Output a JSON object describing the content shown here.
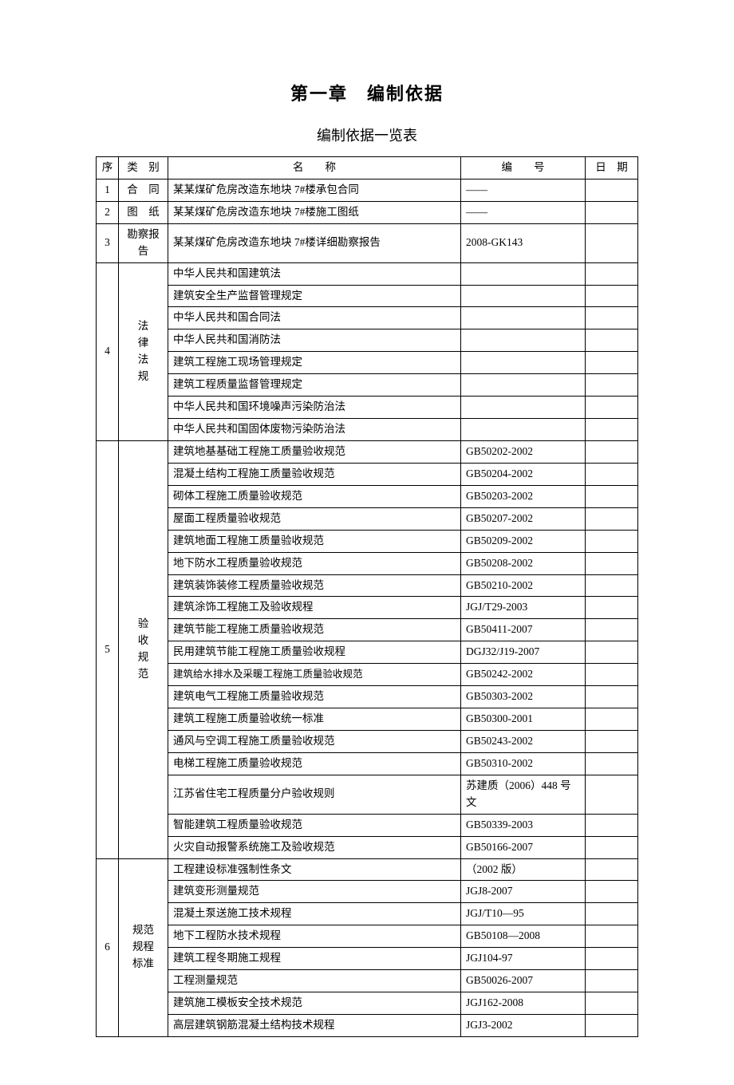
{
  "title": "第一章　编制依据",
  "subtitle": "编制依据一览表",
  "headers": {
    "seq": "序",
    "category": "类　别",
    "name": "名　　称",
    "code": "编　　号",
    "date": "日　期"
  },
  "rows": [
    {
      "seq": "1",
      "category": "合　同",
      "name": "某某煤矿危房改造东地块 7#楼承包合同",
      "code": "——",
      "date": ""
    },
    {
      "seq": "2",
      "category": "图　纸",
      "name": "某某煤矿危房改造东地块 7#楼施工图纸",
      "code": "——",
      "date": ""
    },
    {
      "seq": "3",
      "category": "勘察报告",
      "name": "某某煤矿危房改造东地块 7#楼详细勘察报告",
      "code": "2008-GK143",
      "date": ""
    }
  ],
  "group4": {
    "seq": "4",
    "category_lines": [
      "法",
      "律",
      "法",
      "规"
    ],
    "items": [
      {
        "name": "中华人民共和国建筑法",
        "code": "",
        "date": ""
      },
      {
        "name": "建筑安全生产监督管理规定",
        "code": "",
        "date": ""
      },
      {
        "name": "中华人民共和国合同法",
        "code": "",
        "date": ""
      },
      {
        "name": "中华人民共和国消防法",
        "code": "",
        "date": ""
      },
      {
        "name": "建筑工程施工现场管理规定",
        "code": "",
        "date": ""
      },
      {
        "name": "建筑工程质量监督管理规定",
        "code": "",
        "date": ""
      },
      {
        "name": "中华人民共和国环境噪声污染防治法",
        "code": "",
        "date": ""
      },
      {
        "name": "中华人民共和国固体废物污染防治法",
        "code": "",
        "date": ""
      }
    ]
  },
  "group5": {
    "seq": "5",
    "category_lines": [
      "验",
      "收",
      "规",
      "范"
    ],
    "items": [
      {
        "name": "建筑地基基础工程施工质量验收规范",
        "code": "GB50202-2002",
        "date": ""
      },
      {
        "name": "混凝土结构工程施工质量验收规范",
        "code": "GB50204-2002",
        "date": ""
      },
      {
        "name": "砌体工程施工质量验收规范",
        "code": "GB50203-2002",
        "date": ""
      },
      {
        "name": "屋面工程质量验收规范",
        "code": "GB50207-2002",
        "date": ""
      },
      {
        "name": "建筑地面工程施工质量验收规范",
        "code": "GB50209-2002",
        "date": ""
      },
      {
        "name": "地下防水工程质量验收规范",
        "code": "GB50208-2002",
        "date": ""
      },
      {
        "name": "建筑装饰装修工程质量验收规范",
        "code": "GB50210-2002",
        "date": ""
      },
      {
        "name": "建筑涂饰工程施工及验收规程",
        "code": "JGJ/T29-2003",
        "date": ""
      },
      {
        "name": "建筑节能工程施工质量验收规范",
        "code": "GB50411-2007",
        "date": ""
      },
      {
        "name": "民用建筑节能工程施工质量验收规程",
        "code": "DGJ32/J19-2007",
        "date": ""
      },
      {
        "name": "建筑给水排水及采暖工程施工质量验收规范",
        "code": "GB50242-2002",
        "date": "",
        "small": true
      },
      {
        "name": "建筑电气工程施工质量验收规范",
        "code": "GB50303-2002",
        "date": ""
      },
      {
        "name": "建筑工程施工质量验收统一标准",
        "code": "GB50300-2001",
        "date": ""
      },
      {
        "name": "通风与空调工程施工质量验收规范",
        "code": "GB50243-2002",
        "date": ""
      },
      {
        "name": "电梯工程施工质量验收规范",
        "code": "GB50310-2002",
        "date": ""
      },
      {
        "name": "江苏省住宅工程质量分户验收规则",
        "code": "苏建质（2006）448 号文",
        "date": ""
      },
      {
        "name": "智能建筑工程质量验收规范",
        "code": "GB50339-2003",
        "date": ""
      },
      {
        "name": "火灾自动报警系统施工及验收规范",
        "code": "GB50166-2007",
        "date": ""
      }
    ]
  },
  "group6": {
    "seq": "6",
    "category_lines": [
      "规范",
      "规程",
      "标准"
    ],
    "items": [
      {
        "name": "工程建设标准强制性条文",
        "code": "（2002 版）",
        "date": ""
      },
      {
        "name": "建筑变形测量规范",
        "code": "JGJ8-2007",
        "date": ""
      },
      {
        "name": "混凝土泵送施工技术规程",
        "code": "JGJ/T10—95",
        "date": ""
      },
      {
        "name": "地下工程防水技术规程",
        "code": "GB50108—2008",
        "date": ""
      },
      {
        "name": "建筑工程冬期施工规程",
        "code": "JGJ104-97",
        "date": ""
      },
      {
        "name": "工程测量规范",
        "code": "GB50026-2007",
        "date": ""
      },
      {
        "name": "建筑施工模板安全技术规范",
        "code": "JGJ162-2008",
        "date": ""
      },
      {
        "name": "高层建筑钢筋混凝土结构技术规程",
        "code": "JGJ3-2002",
        "date": ""
      }
    ]
  }
}
